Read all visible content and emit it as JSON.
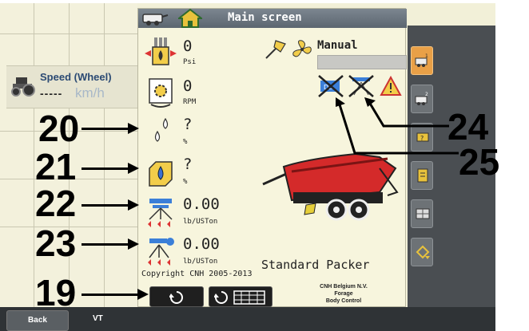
{
  "left_panel": {
    "speed_label": "Speed (Wheel)",
    "speed_value": "-----",
    "speed_unit": "km/h"
  },
  "main": {
    "title": "Main screen",
    "sensors": [
      {
        "name": "pressure",
        "value": "0",
        "unit": "Psi"
      },
      {
        "name": "rotor",
        "value": "0",
        "unit": "RPM"
      },
      {
        "name": "moisture",
        "value": "?",
        "unit": "%"
      },
      {
        "name": "bale-moisture",
        "value": "?",
        "unit": "%"
      },
      {
        "name": "preservative-rate-1",
        "value": "0.00",
        "unit": "lb/USTon"
      },
      {
        "name": "preservative-rate-2",
        "value": "0.00",
        "unit": "lb/USTon"
      }
    ],
    "mode": "Manual",
    "packer": "Standard Packer",
    "copyright": "Copyright CNH 2005-2013",
    "company_lines": [
      "CNH Belgium N.V.",
      "Forage",
      "Body Control"
    ]
  },
  "bottom_bar": {
    "back_label": "Back",
    "vt_label": "VT"
  },
  "callouts": [
    "20",
    "21",
    "22",
    "23",
    "19",
    "24",
    "25"
  ],
  "colors": {
    "screen_bg": "#f2f0d8",
    "title_bar": "#6b7580",
    "active_softkey": "#e9a047",
    "baler_red": "#d42a2a"
  },
  "icons": {
    "title": [
      "baler-icon",
      "home-icon"
    ],
    "sensors": [
      "pressure-icon",
      "rotor-gear-icon",
      "droplets-icon",
      "bale-moisture-icon",
      "sprayer-icon",
      "sprayer-flow-icon"
    ],
    "status": [
      "hammer-icon",
      "fan-icon",
      "sensor-crossed-icon",
      "spray-crossed-icon",
      "warning-icon"
    ],
    "softkeys": [
      "baler-page-1-icon",
      "baler-page-2-icon",
      "help-icon",
      "document-icon",
      "flag-icon",
      "diamond-dropdown-icon"
    ]
  }
}
